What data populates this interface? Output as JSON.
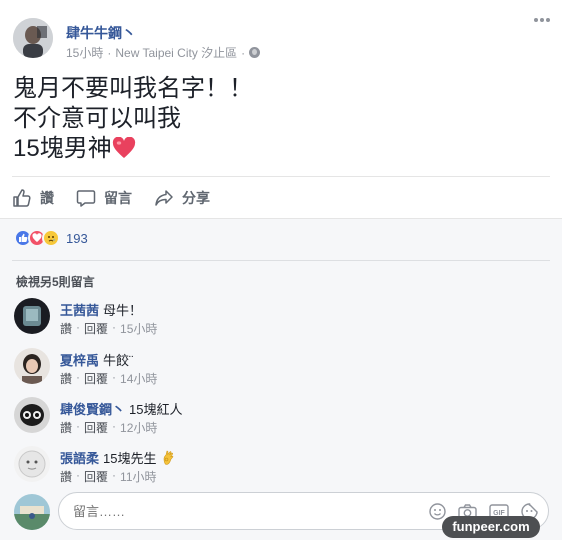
{
  "post": {
    "author": "肆牛牛鋼丶",
    "time": "15小時",
    "separator": "·",
    "location": "New Taipei City 汐止區",
    "lines": [
      "鬼月不要叫我名字！！",
      "不介意可以叫我",
      "15塊男神"
    ],
    "heart_emoji": "heart-emoji"
  },
  "actions": {
    "like_label": "讚",
    "comment_label": "留言",
    "share_label": "分享"
  },
  "reactions": {
    "icons": [
      "like-icon",
      "love-icon",
      "sad-icon"
    ],
    "count": "193"
  },
  "comments_header": {
    "view_more": "檢視另5則留言"
  },
  "comments": [
    {
      "name": "王茜茜",
      "text": "母牛！",
      "like": "讚",
      "reply": "回覆",
      "dot": "·",
      "time": "15小時"
    },
    {
      "name": "夏梓禹",
      "text": "牛餃¨",
      "like": "讚",
      "reply": "回覆",
      "dot": "·",
      "time": "14小時"
    },
    {
      "name": "肆俊賢鋼丶",
      "text": "15塊紅人",
      "like": "讚",
      "reply": "回覆",
      "dot": "·",
      "time": "12小時"
    },
    {
      "name": "張語柔",
      "text": "15塊先生",
      "like": "讚",
      "reply": "回覆",
      "dot": "·",
      "time": "11小時"
    }
  ],
  "composer": {
    "placeholder": "留言……",
    "icons": [
      "emoji-icon",
      "camera-icon",
      "gif-icon",
      "sticker-icon"
    ]
  },
  "watermark": "funpeer.com",
  "colors": {
    "link_blue": "#365899",
    "like_blue": "#4a78e8",
    "love_red": "#f25268",
    "sad_yellow": "#f7c83a",
    "meta_gray": "#90949c"
  }
}
